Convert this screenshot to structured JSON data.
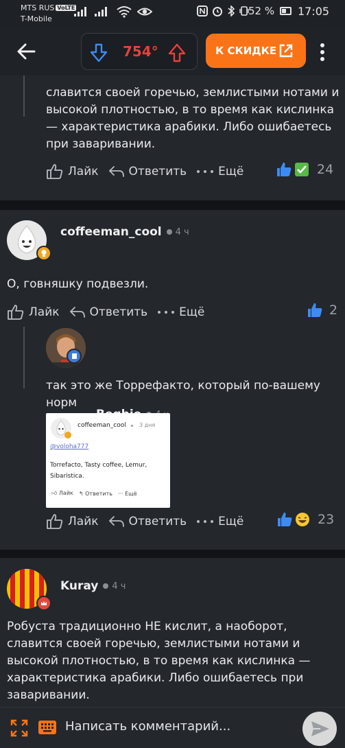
{
  "status_bar": {
    "carrier_line1": "MTS RUS",
    "volte": "VoLTE",
    "carrier_line2": "T-Mobile",
    "battery": "52 %",
    "time": "17:05"
  },
  "toolbar": {
    "rating": "754°",
    "discount_label": "К СКИДКЕ"
  },
  "actions": {
    "like": "Лайк",
    "reply": "Ответить",
    "more": "Ещё"
  },
  "comments": {
    "c0": {
      "text_partial": "славится своей горечью, землистыми нотами и высокой плотностью, в то время как кислинка — характеристика арабики. Либо ошибаетесь при заваривании.",
      "likes": "24"
    },
    "c1": {
      "author": "coffeeman_cool",
      "time": "4 ч",
      "text": "О, говняшку подвезли.",
      "likes": "2"
    },
    "c2": {
      "author": "Begbie",
      "time": "4 ч",
      "text": "так это же Торрефакто, который по-вашему норм",
      "likes": "23",
      "embed": {
        "author": "coffeeman_cool",
        "time": "3 дня",
        "mention": "@voloha777",
        "text": "Torrefacto, Tasty coffee, Lemur, Sibaristica.",
        "like": "Лайк",
        "reply": "Ответить",
        "more": "Ещё"
      }
    },
    "c3": {
      "author": "Kuray",
      "time": "4 ч",
      "text": "Робуста традиционно НЕ кислит, а наоборот, славится своей горечью, землистыми нотами и высокой плотностью, в то время как кислинка — характеристика арабики. Либо ошибаетесь при заваривании."
    }
  },
  "composer": {
    "placeholder": "Написать комментарий..."
  },
  "colors": {
    "background": "#24272c",
    "separator": "#111316",
    "accent_orange": "#fa7417",
    "rating_red": "#e8403a",
    "rating_down_blue": "#3d8bf2",
    "like_blue": "#3d8bf2"
  },
  "icons": [
    "back-arrow-icon",
    "downvote-icon",
    "upvote-icon",
    "external-link-icon",
    "more-vertical-icon",
    "like-icon",
    "reply-icon",
    "more-dots-icon",
    "thumbs-up-icon",
    "check-emoji-icon",
    "laughing-emoji-icon",
    "expand-icon",
    "keyboard-icon",
    "send-icon"
  ]
}
